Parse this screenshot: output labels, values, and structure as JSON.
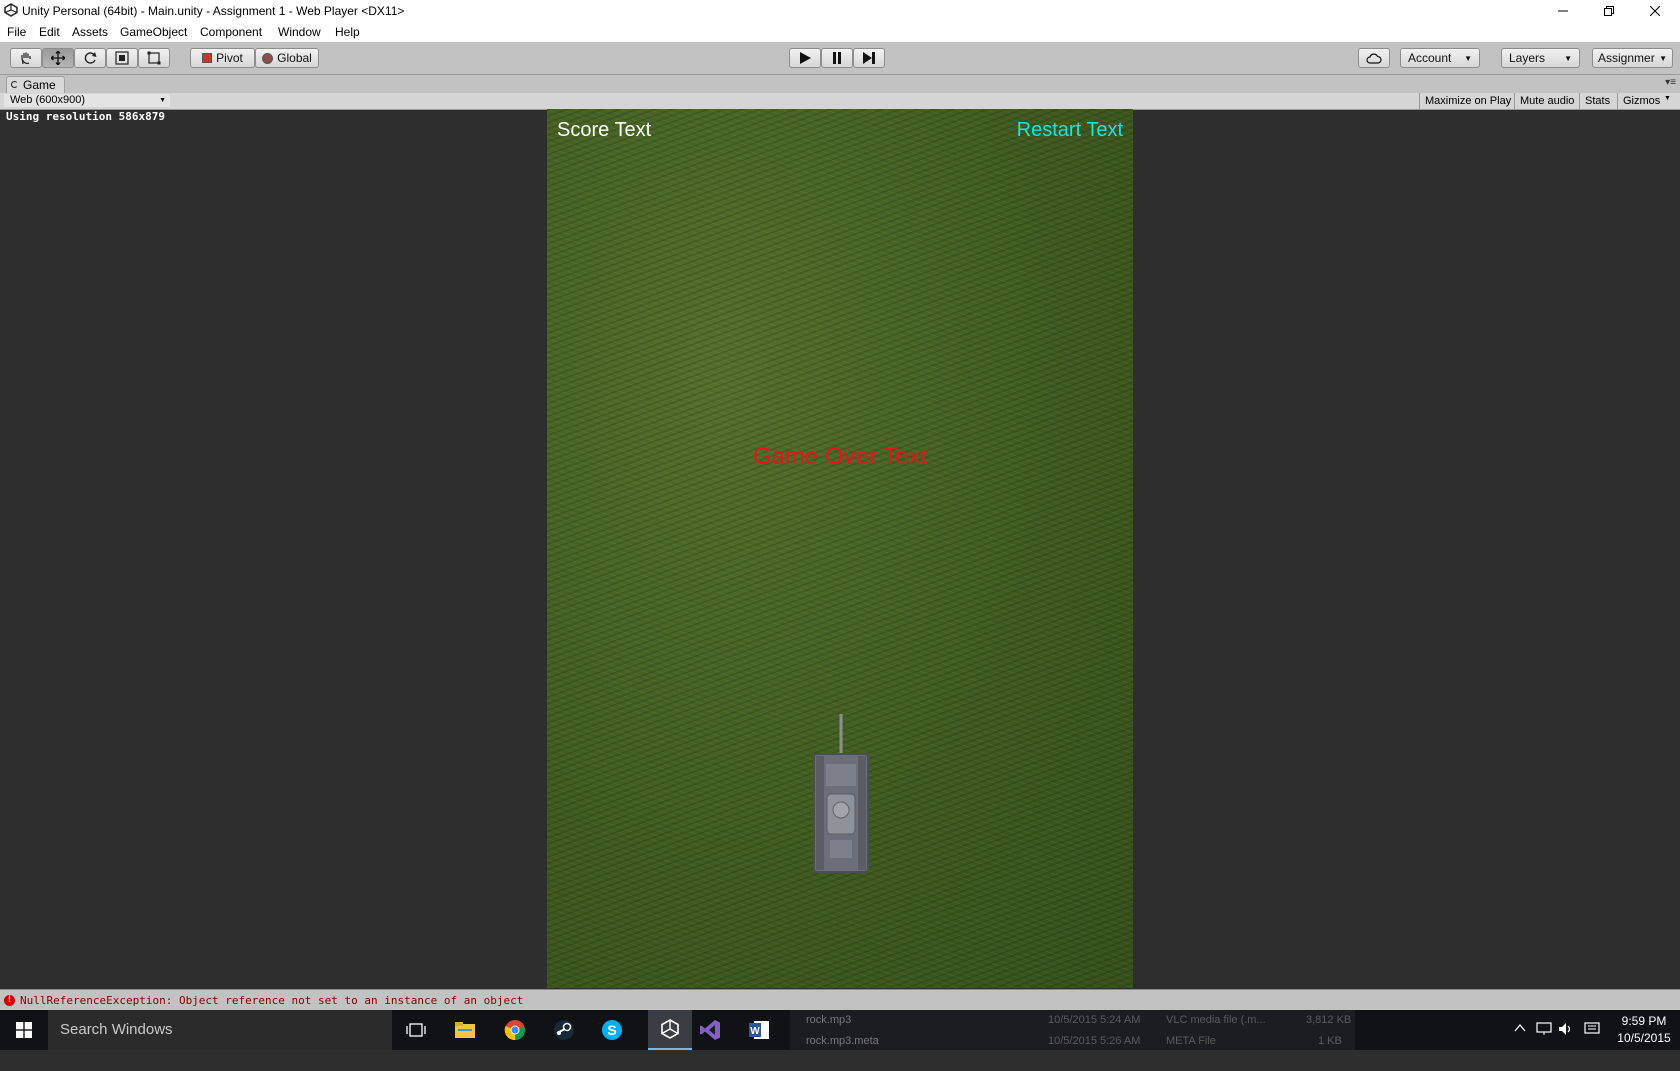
{
  "window": {
    "title": "Unity Personal (64bit) - Main.unity - Assignment 1 - Web Player <DX11>"
  },
  "menu": [
    "File",
    "Edit",
    "Assets",
    "GameObject",
    "Component",
    "Window",
    "Help"
  ],
  "toolbar": {
    "pivot_label": "Pivot",
    "global_label": "Global",
    "account_label": "Account",
    "layers_label": "Layers",
    "layout_label": "Assignmer"
  },
  "tab": {
    "label": "Game"
  },
  "gamebar": {
    "resolution": "Web (600x900)",
    "maximize": "Maximize on Play",
    "mute": "Mute audio",
    "stats": "Stats",
    "gizmos": "Gizmos"
  },
  "viewport": {
    "resolution_info": "Using resolution 586x879"
  },
  "game": {
    "score_text": "Score Text",
    "restart_text": "Restart Text",
    "game_over_text": "Game Over Text"
  },
  "status": {
    "error_message": "NullReferenceException: Object reference not set to an instance of an object"
  },
  "taskbar": {
    "search_placeholder": "Search Windows",
    "background_file_1": "rock.mp3",
    "background_file_1_date": "10/5/2015 5:24 AM",
    "background_file_1_type": "VLC media file (.m...",
    "background_file_1_size": "3,812 KB",
    "background_file_2": "rock.mp3.meta",
    "background_file_2_date": "10/5/2015 5:26 AM",
    "background_file_2_type": "META File",
    "background_file_2_size": "1 KB",
    "time": "9:59 PM",
    "date": "10/5/2015"
  },
  "colors": {
    "score": "#ffffff",
    "restart": "#1de0e8",
    "game_over": "#e2161c"
  }
}
